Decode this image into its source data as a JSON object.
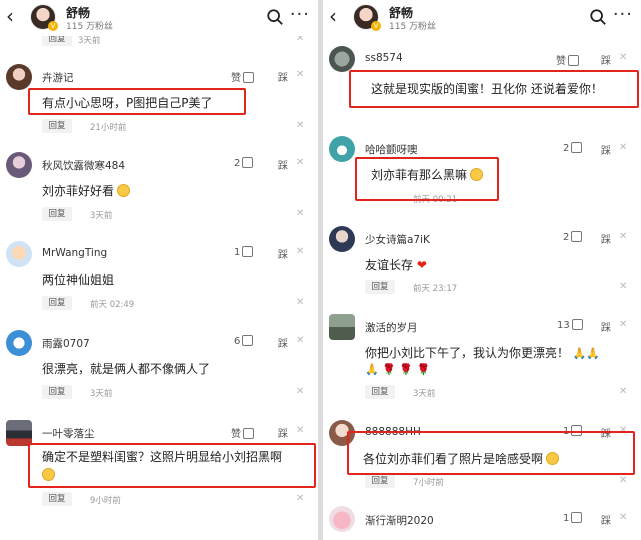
{
  "left": {
    "header": {
      "name": "舒畅",
      "fans": "115 万粉丝"
    },
    "top_partial": {
      "reply": "回复",
      "time": "3天前"
    },
    "comments": [
      {
        "user": "卉游记",
        "likes": "赞",
        "text": "有点小心思呀，P图把自己P美了",
        "reply": "回复",
        "time": "21小时前",
        "dislike": "踩"
      },
      {
        "user": "秋风饮露微寒484",
        "likes": "2",
        "text": "刘亦菲好好看",
        "reply": "回复",
        "time": "3天前",
        "dislike": "踩"
      },
      {
        "user": "MrWangTing",
        "likes": "1",
        "text": "两位神仙姐姐",
        "reply": "回复",
        "time": "前天 02:49",
        "dislike": "踩"
      },
      {
        "user": "雨露0707",
        "likes": "6",
        "text": "很漂亮，就是俩人都不像俩人了",
        "reply": "回复",
        "time": "3天前",
        "dislike": "踩"
      },
      {
        "user": "一叶零落尘",
        "likes": "赞",
        "text": "确定不是塑料闺蜜？这照片明显给小刘招黑啊",
        "reply": "回复",
        "time": "9小时前",
        "dislike": "踩"
      }
    ]
  },
  "right": {
    "header": {
      "name": "舒畅",
      "fans": "115 万粉丝"
    },
    "comments": [
      {
        "user": "ss8574",
        "likes": "赞",
        "text": "这就是现实版的闺蜜！丑化你 还说着爱你！",
        "reply": "回复",
        "time": "",
        "dislike": "踩"
      },
      {
        "user": "哈哈颤呀噢",
        "likes": "2",
        "text": "刘亦菲有那么黑嘛",
        "reply": "回复",
        "time": "前天 00:21",
        "dislike": "踩"
      },
      {
        "user": "少女诗篇a7iK",
        "likes": "2",
        "text": "友谊长存",
        "reply": "回复",
        "time": "前天 23:17",
        "dislike": "踩"
      },
      {
        "user": "激活的岁月",
        "likes": "13",
        "text": "你把小刘比下午了，我认为你更漂亮！",
        "reply": "回复",
        "time": "3天前",
        "dislike": "踩"
      },
      {
        "user": "888888HH",
        "likes": "1",
        "text": "各位刘亦菲们看了照片是啥感受啊",
        "reply": "回复",
        "time": "7小时前",
        "dislike": "踩"
      },
      {
        "user": "渐行渐明2020",
        "likes": "1",
        "text": "",
        "reply": "",
        "time": "",
        "dislike": "踩"
      }
    ]
  }
}
